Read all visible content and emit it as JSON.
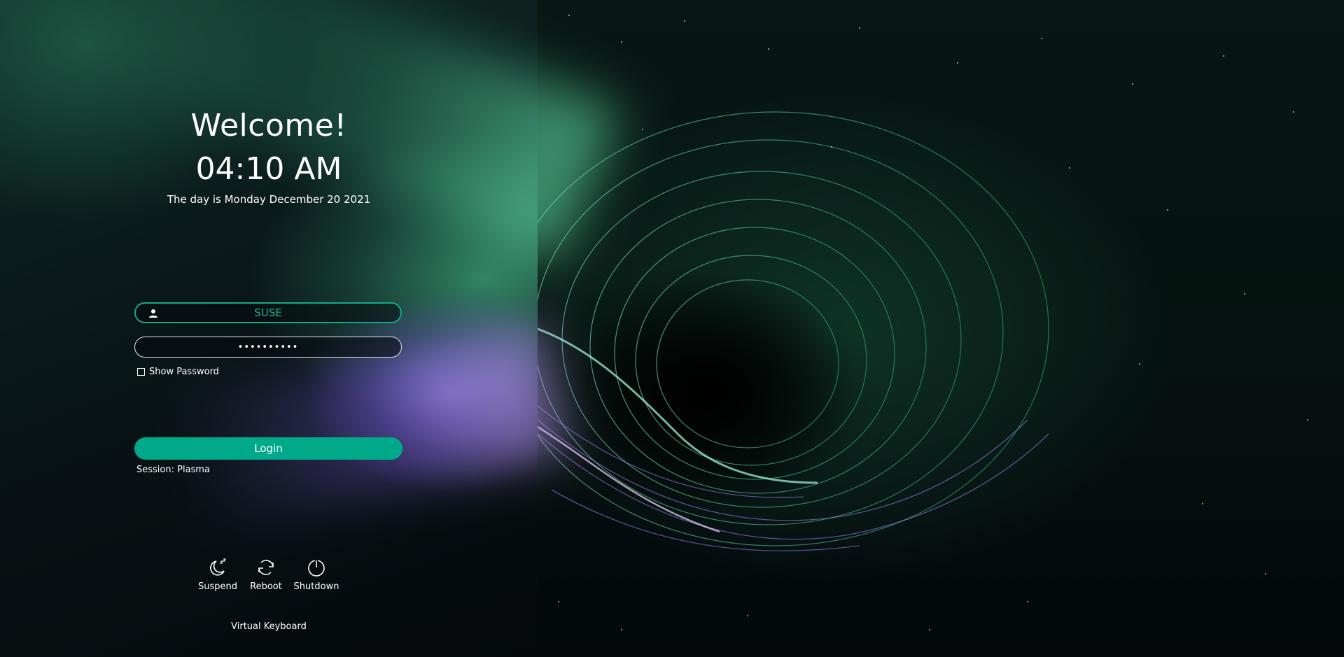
{
  "greeting": "Welcome!",
  "clock": "04:10 AM",
  "date": "The day is Monday December 20 2021",
  "user_field": {
    "value": "SUSE",
    "icon": "user-icon"
  },
  "password_field": {
    "value": "••••••••••"
  },
  "show_password": {
    "label": "Show Password",
    "checked": false
  },
  "login_button": {
    "label": "Login"
  },
  "session": {
    "label": "Session: Plasma"
  },
  "power_actions": [
    {
      "label": "Suspend",
      "icon": "moon-icon"
    },
    {
      "label": "Reboot",
      "icon": "reboot-icon"
    },
    {
      "label": "Shutdown",
      "icon": "power-icon"
    }
  ],
  "virtual_keyboard": {
    "label": "Virtual Keyboard"
  },
  "colors": {
    "accent": "#00a98a",
    "user_field_border": "#17a88a",
    "user_field_text": "#1fb596"
  }
}
